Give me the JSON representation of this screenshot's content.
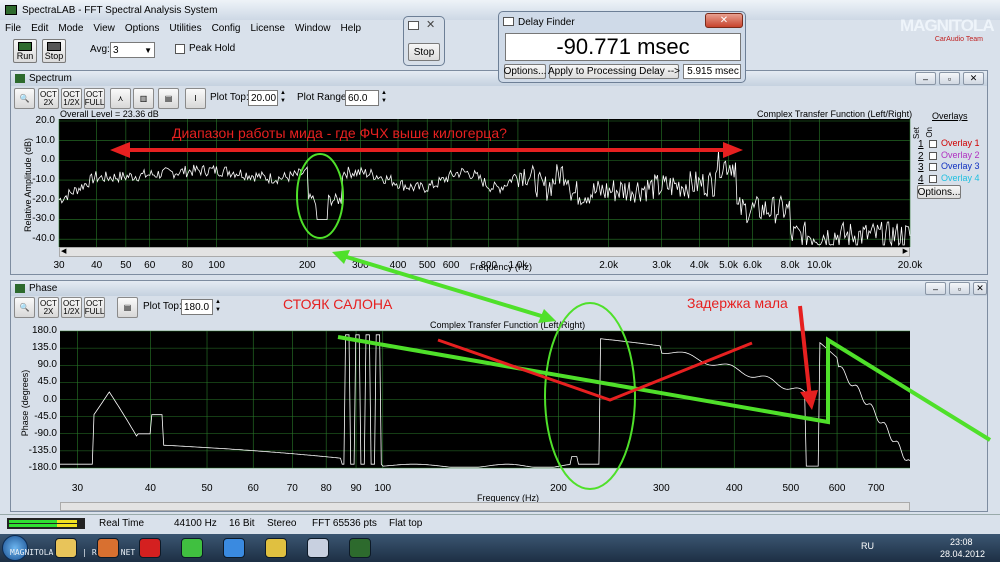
{
  "app": {
    "title": "SpectraLAB - FFT Spectral Analysis System"
  },
  "menu": [
    "File",
    "Edit",
    "Mode",
    "View",
    "Options",
    "Utilities",
    "Config",
    "License",
    "Window",
    "Help"
  ],
  "toolbar": {
    "run": "Run",
    "stop": "Stop",
    "avg_label": "Avg:",
    "avg_value": "3",
    "peak_hold": "Peak Hold"
  },
  "mini": {
    "stop": "Stop"
  },
  "delay": {
    "title": "Delay Finder",
    "value": "-90.771 msec",
    "options": "Options...",
    "apply": "Apply to Processing Delay -->",
    "small": "5.915 msec"
  },
  "logo": {
    "brand": "MAGNITOLA",
    "sub": "CarAudio Team"
  },
  "spectrum": {
    "title": "Spectrum",
    "plot_top_label": "Plot Top:",
    "plot_top": "20.00",
    "range_label": "Plot Range:",
    "range": "60.0",
    "overall": "Overall Level = 23.36 dB",
    "ctf": "Complex Transfer Function (Left/Right)",
    "ylabel": "Relative Amplitude (dB)",
    "yticks": [
      "20.0",
      "10.0",
      "0.0",
      "-10.0",
      "-20.0",
      "-30.0",
      "-40.0"
    ],
    "xticks": [
      "30",
      "40",
      "50",
      "60",
      "80",
      "100",
      "200",
      "300",
      "400",
      "500",
      "600",
      "800",
      "1.0k",
      "2.0k",
      "3.0k",
      "4.0k",
      "5.0k",
      "6.0k",
      "8.0k",
      "10.0k",
      "20.0k"
    ],
    "xlabel": "Frequency (Hz)",
    "annotation": "Диапазон работы мида - где ФЧХ выше килогерца?",
    "overlays": {
      "title": "Overlays",
      "set": "Set",
      "on": "On",
      "items": [
        {
          "n": "1",
          "label": "Overlay 1",
          "color": "#d00000"
        },
        {
          "n": "2",
          "label": "Overlay 2",
          "color": "#b030c0"
        },
        {
          "n": "3",
          "label": "Overlay 3",
          "color": "#1030c0"
        },
        {
          "n": "4",
          "label": "Overlay 4",
          "color": "#20c0e0"
        }
      ],
      "options": "Options..."
    }
  },
  "phase": {
    "title": "Phase",
    "plot_top_label": "Plot Top:",
    "plot_top": "180.0",
    "ctf": "Complex Transfer Function (Left/Right)",
    "ylabel": "Phase (degrees)",
    "yticks": [
      "180.0",
      "135.0",
      "90.0",
      "45.0",
      "0.0",
      "-45.0",
      "-90.0",
      "-135.0",
      "-180.0"
    ],
    "xticks": [
      "30",
      "40",
      "50",
      "60",
      "70",
      "80",
      "90",
      "100",
      "200",
      "300",
      "400",
      "500",
      "600",
      "700"
    ],
    "xlabel": "Frequency (Hz)",
    "annotation1": "СТОЯК САЛОНА",
    "annotation2": "Задержка мала"
  },
  "status": {
    "mode": "Real Time",
    "rate": "44100 Hz",
    "bits": "16 Bit",
    "channels": "Stereo",
    "fft": "FFT 65536 pts",
    "window": "Flat top"
  },
  "taskbar": {
    "start_label": "MAGNITOLA.ORG1 | RU1 | NET",
    "lang": "RU",
    "time": "23:08",
    "date": "28.04.2012",
    "apps": [
      "folder",
      "media",
      "opera",
      "icq",
      "chrome",
      "paint",
      "cd",
      "spectralab"
    ]
  },
  "colors": {
    "annotation_red": "#e62020",
    "annotation_green": "#4fe02a",
    "trace": "#ffffff",
    "grid": "#2a7a2a",
    "plot_bg": "#000000"
  }
}
